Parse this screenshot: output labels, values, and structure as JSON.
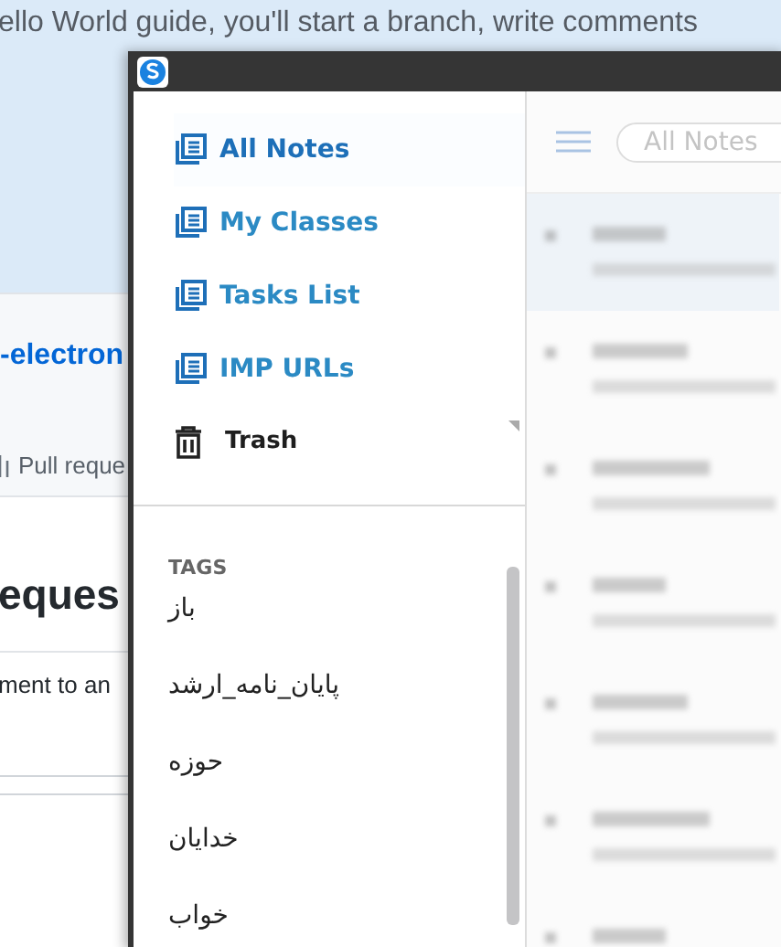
{
  "background_page": {
    "intro_text": "ello World guide, you'll start a branch, write comments",
    "repo_link": "-electron",
    "pull_requests_tab": "Pull reque",
    "heading": "eques",
    "body_text": "ment to an"
  },
  "window": {
    "sidebar": {
      "items": [
        {
          "label": "All Notes",
          "kind": "notes",
          "selected": true
        },
        {
          "label": "My Classes",
          "kind": "notes",
          "selected": false
        },
        {
          "label": "Tasks List",
          "kind": "notes",
          "selected": false
        },
        {
          "label": "IMP URLs",
          "kind": "notes",
          "selected": false
        },
        {
          "label": "Trash",
          "kind": "trash",
          "selected": false
        }
      ],
      "tags_heading": "TAGS",
      "tags": [
        "باز",
        "پایان_نامه_ارشد",
        "حوزه",
        "خدایان",
        "خواب"
      ]
    },
    "note_list": {
      "search": {
        "placeholder": "All Notes"
      }
    }
  }
}
